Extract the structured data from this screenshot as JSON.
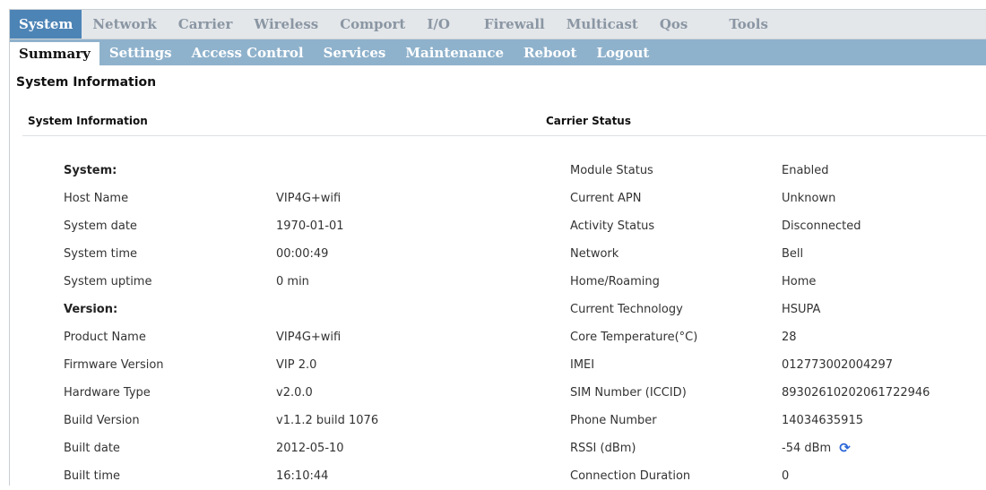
{
  "topnav": [
    "System",
    "Network",
    "Carrier",
    "Wireless",
    "Comport",
    "I/O",
    "Firewall",
    "Multicast",
    "Qos",
    "Tools"
  ],
  "subnav": [
    "Summary",
    "Settings",
    "Access Control",
    "Services",
    "Maintenance",
    "Reboot",
    "Logout"
  ],
  "page_title": "System Information",
  "left_section": {
    "header": "System Information",
    "rows": [
      {
        "label": "System:",
        "value": "",
        "bold": true
      },
      {
        "label": "Host Name",
        "value": "VIP4G+wifi"
      },
      {
        "label": "System date",
        "value": "1970-01-01"
      },
      {
        "label": "System time",
        "value": "00:00:49"
      },
      {
        "label": "System uptime",
        "value": "0 min"
      },
      {
        "label": "Version:",
        "value": "",
        "bold": true
      },
      {
        "label": "Product Name",
        "value": "VIP4G+wifi"
      },
      {
        "label": "Firmware Version",
        "value": "VIP 2.0"
      },
      {
        "label": "Hardware Type",
        "value": "v2.0.0"
      },
      {
        "label": "Build Version",
        "value": "v1.1.2 build 1076"
      },
      {
        "label": "Built date",
        "value": "2012-05-10"
      },
      {
        "label": "Built time",
        "value": "16:10:44"
      }
    ]
  },
  "right_section": {
    "header": "Carrier Status",
    "rows": [
      {
        "label": "Module Status",
        "value": "Enabled"
      },
      {
        "label": "Current APN",
        "value": "Unknown"
      },
      {
        "label": "Activity Status",
        "value": "Disconnected"
      },
      {
        "label": "Network",
        "value": "Bell"
      },
      {
        "label": "Home/Roaming",
        "value": "Home"
      },
      {
        "label": "Current Technology",
        "value": "HSUPA"
      },
      {
        "label": "Core Temperature(°C)",
        "value": "28"
      },
      {
        "label": "IMEI",
        "value": "012773002004297"
      },
      {
        "label": "SIM Number (ICCID)",
        "value": "89302610202061722946"
      },
      {
        "label": "Phone Number",
        "value": "14034635915"
      },
      {
        "label": "RSSI (dBm)",
        "value": "-54 dBm",
        "icon": "refresh-icon"
      },
      {
        "label": "Connection Duration",
        "value": "0"
      }
    ]
  },
  "colors": {
    "active_tab": "#4d84b6",
    "subnav": "#8fb2cc",
    "refresh_icon": "#2a67d8"
  }
}
